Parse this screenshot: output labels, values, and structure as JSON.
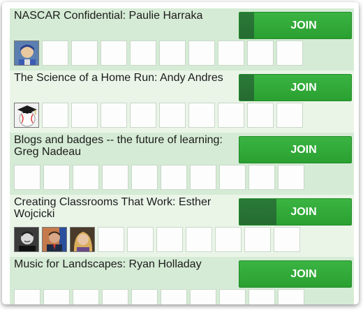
{
  "sessions": [
    {
      "title": "NASCAR Confidential: Paulie Harraka",
      "join_label": "JOIN",
      "progress": 0.13,
      "avatars": [
        "racing-driver-avatar"
      ]
    },
    {
      "title": "The Science of a Home Run: Andy Andres",
      "join_label": "JOIN",
      "progress": 0.13,
      "avatars": [
        "graduation-baseball-avatar"
      ]
    },
    {
      "title": "Blogs and badges -- the future of learning: Greg Nadeau",
      "join_label": "JOIN",
      "progress": 0,
      "avatars": []
    },
    {
      "title": "Creating Classrooms That Work: Esther Wojcicki",
      "join_label": "JOIN",
      "progress": 0.33,
      "avatars": [
        "man-smiling-avatar",
        "man-suit-avatar",
        "woman-blonde-avatar"
      ]
    },
    {
      "title": "Music for Landscapes: Ryan Holladay",
      "join_label": "JOIN",
      "progress": 0,
      "avatars": []
    }
  ],
  "slots_per_session": 10,
  "colors": {
    "join_green": "#2aa031",
    "join_filled": "#256b31",
    "row_alt": "#d5ebd5",
    "row_plain": "#eaf5e8"
  }
}
